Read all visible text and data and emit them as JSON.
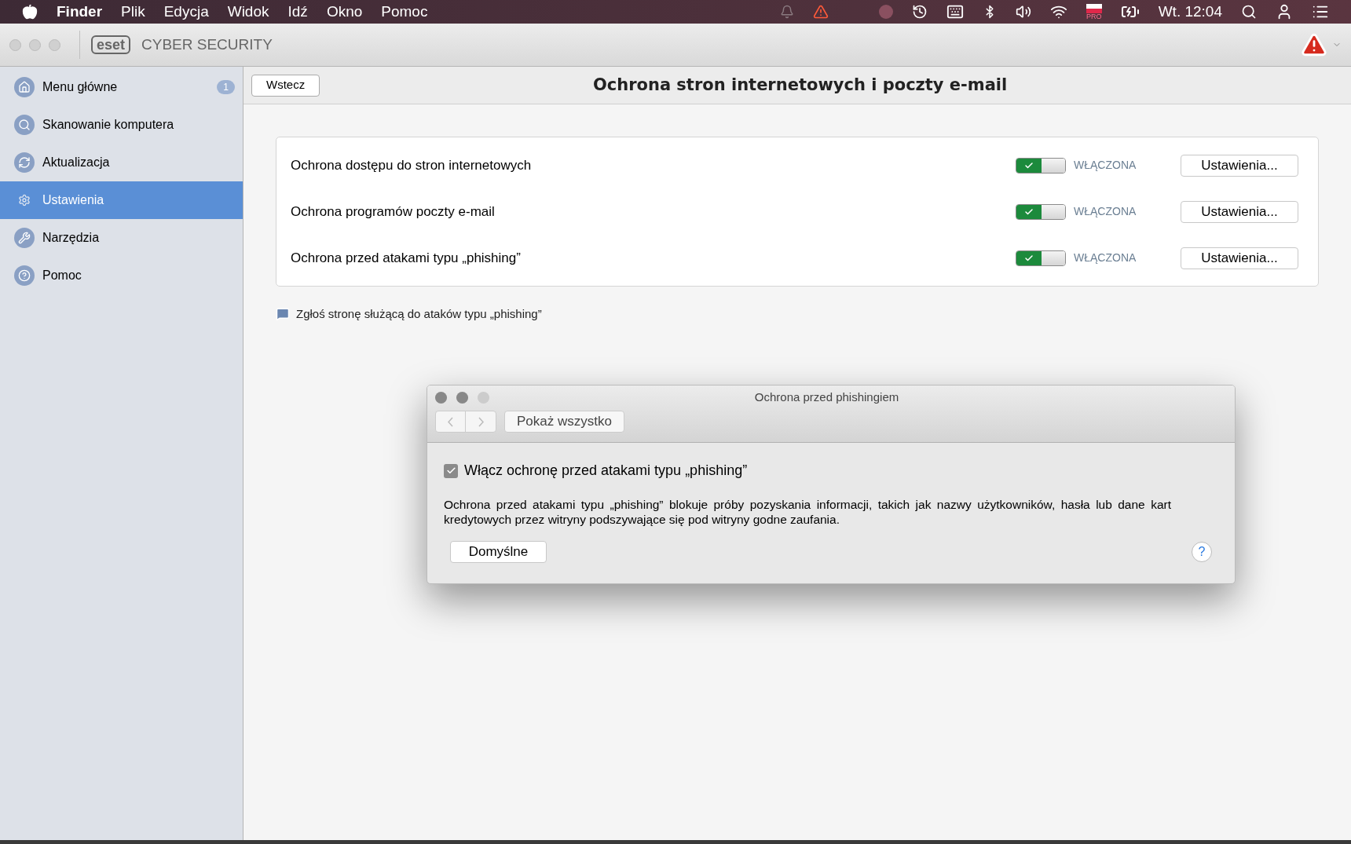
{
  "menu_bar": {
    "app": "Finder",
    "items": [
      "Plik",
      "Edycja",
      "Widok",
      "Idź",
      "Okno",
      "Pomoc"
    ],
    "flag_badge": "PRO",
    "clock": "Wt. 12:04"
  },
  "window": {
    "logo": "eset",
    "title": "CYBER SECURITY"
  },
  "sidebar": {
    "items": [
      {
        "label": "Menu główne",
        "badge": "1",
        "selected": false
      },
      {
        "label": "Skanowanie komputera",
        "selected": false
      },
      {
        "label": "Aktualizacja",
        "selected": false
      },
      {
        "label": "Ustawienia",
        "selected": true
      },
      {
        "label": "Narzędzia",
        "selected": false
      },
      {
        "label": "Pomoc",
        "selected": false
      }
    ]
  },
  "header": {
    "back": "Wstecz",
    "title": "Ochrona stron internetowych i poczty e-mail"
  },
  "settings": [
    {
      "label": "Ochrona dostępu do stron internetowych",
      "on": true,
      "status": "WŁĄCZONA",
      "button": "Ustawienia..."
    },
    {
      "label": "Ochrona programów poczty e-mail",
      "on": true,
      "status": "WŁĄCZONA",
      "button": "Ustawienia..."
    },
    {
      "label": "Ochrona przed atakami typu „phishing”",
      "on": true,
      "status": "WŁĄCZONA",
      "button": "Ustawienia..."
    }
  ],
  "report_link": "Zgłoś stronę służącą do ataków typu „phishing”",
  "dialog": {
    "title": "Ochrona przed phishingiem",
    "show_all": "Pokaż wszystko",
    "checkbox": {
      "label": "Włącz ochronę przed atakami typu „phishing”",
      "checked": true
    },
    "description": "Ochrona przed atakami typu „phishing” blokuje próby pozyskania informacji, takich jak nazwy użytkowników, hasła lub dane kart kredytowych przez witryny podszywające się pod witryny godne zaufania.",
    "default_button": "Domyślne",
    "help": "?"
  }
}
